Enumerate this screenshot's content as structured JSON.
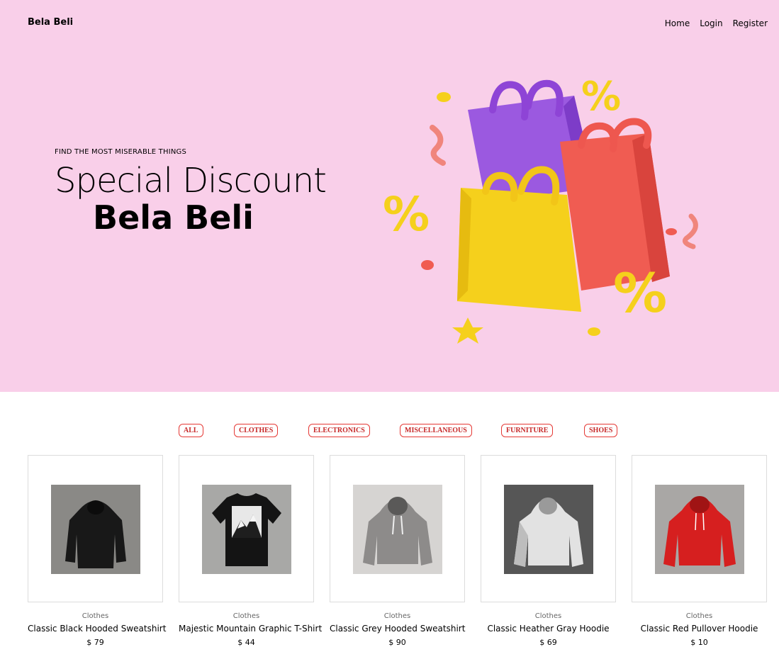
{
  "header": {
    "brand": "Bela Beli",
    "nav": [
      "Home",
      "Login",
      "Register"
    ]
  },
  "hero": {
    "tagline": "FIND THE MOST MISERABLE THINGS",
    "headline": "Special Discount",
    "brand": "Bela Beli",
    "background": "#f9cfe9"
  },
  "filters": [
    "ALL",
    "CLOTHES",
    "ELECTRONICS",
    "MISCELLANEOUS",
    "FURNITURE",
    "SHOES"
  ],
  "products": [
    {
      "category": "Clothes",
      "title": "Classic Black Hooded Sweatshirt",
      "price": "$ 79"
    },
    {
      "category": "Clothes",
      "title": "Majestic Mountain Graphic T-Shirt",
      "price": "$ 44"
    },
    {
      "category": "Clothes",
      "title": "Classic Grey Hooded Sweatshirt",
      "price": "$ 90"
    },
    {
      "category": "Clothes",
      "title": "Classic Heather Gray Hoodie",
      "price": "$ 69"
    },
    {
      "category": "Clothes",
      "title": "Classic Red Pullover Hoodie",
      "price": "$ 10"
    }
  ],
  "colors": {
    "accent": "#e53935",
    "hero_bg": "#f9cfe9"
  }
}
